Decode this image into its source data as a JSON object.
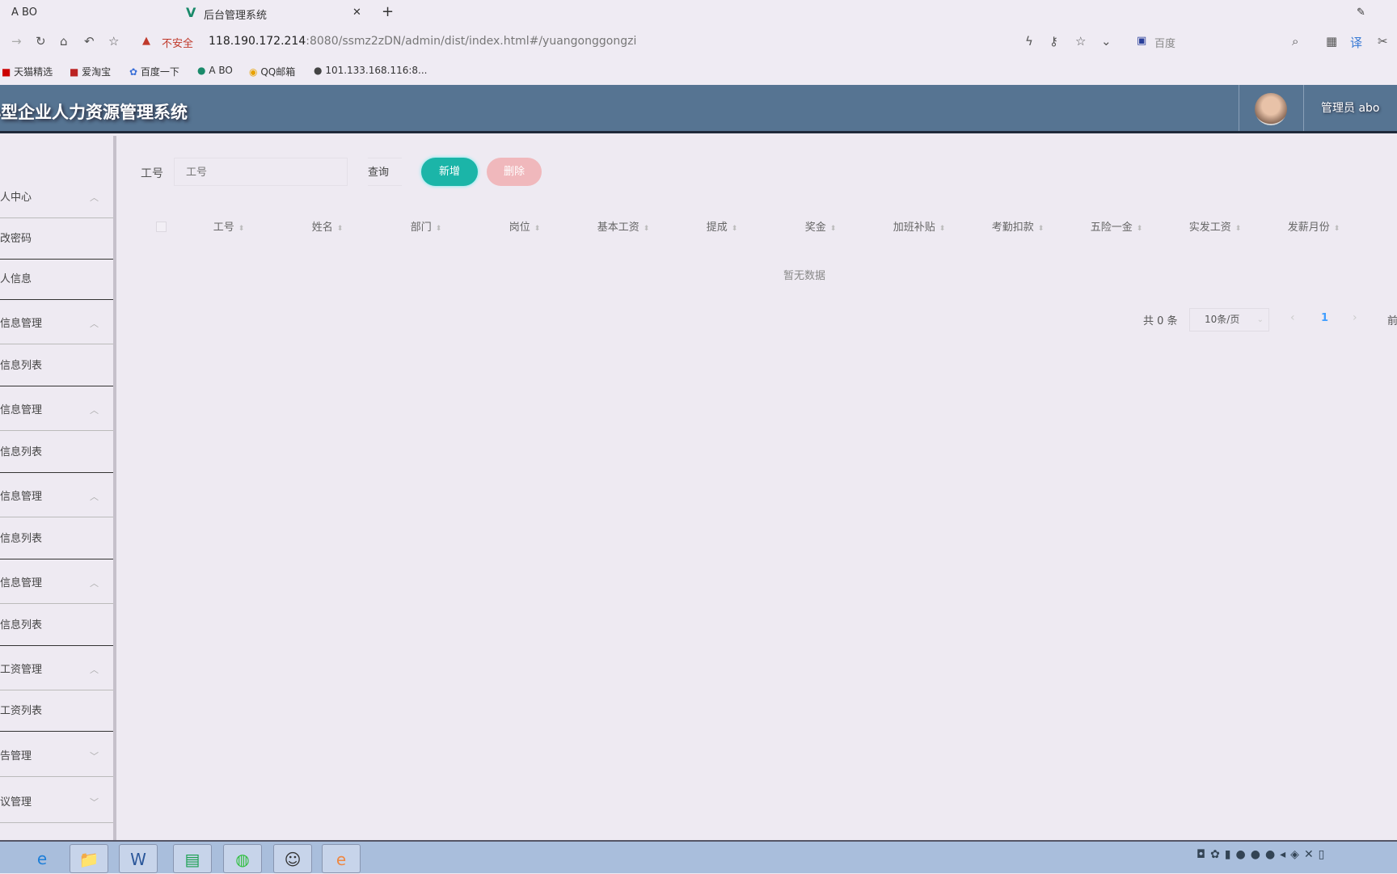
{
  "browser": {
    "tabs": [
      {
        "label": "A BO"
      },
      {
        "label": "后台管理系统"
      }
    ],
    "security": "不安全",
    "url_host": "118.190.172.214",
    "url_rest": ":8080/ssmz2zDN/admin/dist/index.html#/yuangonggongzi",
    "search_engine": "百度",
    "bookmarks": [
      {
        "label": "天猫精选"
      },
      {
        "label": "爱淘宝"
      },
      {
        "label": "百度一下"
      },
      {
        "label": "A BO"
      },
      {
        "label": "QQ邮箱"
      },
      {
        "label": "101.133.168.116:8..."
      }
    ]
  },
  "header": {
    "title": "小型企业人力资源管理系统",
    "user": "管理员 abo"
  },
  "sidebar": {
    "items": [
      {
        "label": "个人中心",
        "type": "group",
        "expanded": true
      },
      {
        "label": "修改密码",
        "type": "sub"
      },
      {
        "label": "个人信息",
        "type": "sub"
      },
      {
        "label": "员工信息管理",
        "type": "group",
        "expanded": true
      },
      {
        "label": "员工信息列表",
        "type": "sub"
      },
      {
        "label": "部门信息管理",
        "type": "group",
        "expanded": true
      },
      {
        "label": "部门信息列表",
        "type": "sub"
      },
      {
        "label": "考勤信息管理",
        "type": "group",
        "expanded": true
      },
      {
        "label": "考勤信息列表",
        "type": "sub"
      },
      {
        "label": "培训信息管理",
        "type": "group",
        "expanded": true
      },
      {
        "label": "培训信息列表",
        "type": "sub"
      },
      {
        "label": "员工工资管理",
        "type": "group",
        "expanded": true
      },
      {
        "label": "员工工资列表",
        "type": "sub"
      },
      {
        "label": "公告管理",
        "type": "group",
        "expanded": false
      },
      {
        "label": "异议管理",
        "type": "group",
        "expanded": false
      }
    ]
  },
  "search": {
    "label": "工号",
    "placeholder": "工号",
    "query": "查询",
    "add": "新增",
    "delete": "删除"
  },
  "table": {
    "columns": [
      "工号",
      "姓名",
      "部门",
      "岗位",
      "基本工资",
      "提成",
      "奖金",
      "加班补贴",
      "考勤扣款",
      "五险一金",
      "实发工资",
      "发薪月份"
    ],
    "empty": "暂无数据"
  },
  "pagination": {
    "total": "共 0 条",
    "page_size": "10条/页",
    "current": "1",
    "jump": "前往"
  },
  "colors": {
    "header": "#567492",
    "add": "#1bb5a8",
    "delete": "#f0b8bc",
    "active_page": "#409eff"
  }
}
